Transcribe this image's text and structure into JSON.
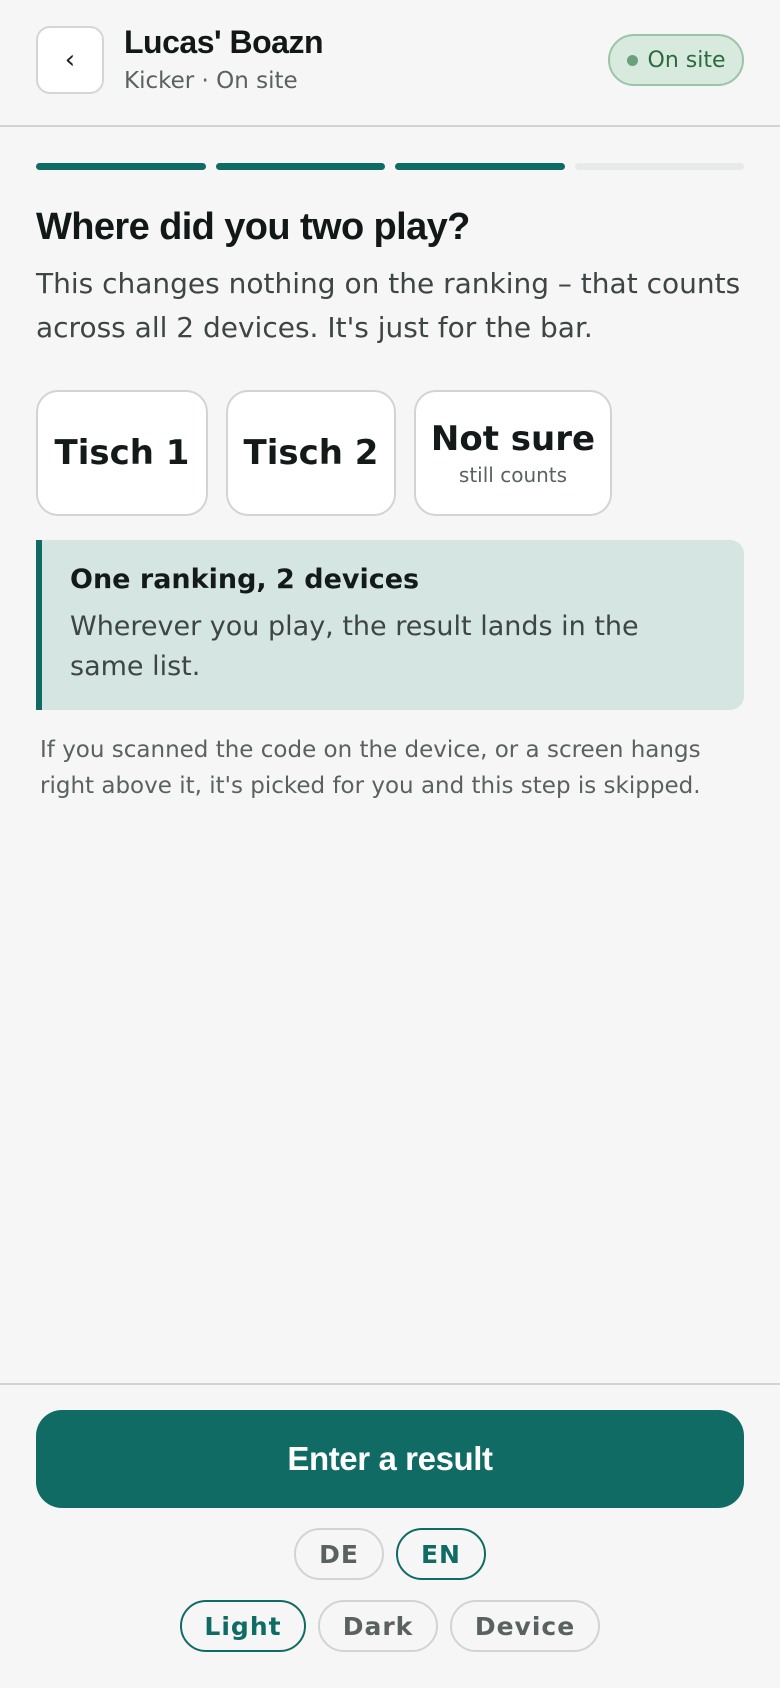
{
  "header": {
    "back_icon": "chevron-left-icon",
    "back_glyph": "‹",
    "title": "Lucas' Boazn",
    "subtitle": "Kicker · On site",
    "status_badge": "On site",
    "status_color": "#6aa07c"
  },
  "progress": {
    "total_steps": 4,
    "completed_steps": 3
  },
  "question": {
    "heading": "Where did you two play?",
    "description": "This changes nothing on the ranking – that counts across all 2 devices. It's just for the bar."
  },
  "options": [
    {
      "label": "Tisch 1",
      "sublabel": ""
    },
    {
      "label": "Tisch 2",
      "sublabel": ""
    },
    {
      "label": "Not sure",
      "sublabel": "still counts"
    }
  ],
  "info_card": {
    "title": "One ranking, 2 devices",
    "body": "Wherever you play, the result lands in the same list."
  },
  "note": "If you scanned the code on the device, or a screen hangs right above it, it's picked for you and this step is skipped.",
  "cta": {
    "label": "Enter a result"
  },
  "language": {
    "options": [
      "DE",
      "EN"
    ],
    "selected": "EN"
  },
  "theme": {
    "options": [
      "Light",
      "Dark",
      "Device"
    ],
    "selected": "Light"
  },
  "colors": {
    "accent": "#0f6b63",
    "background": "#f6f6f6",
    "info_bg": "#d5e5e1",
    "badge_bg": "#d8e9dd"
  }
}
